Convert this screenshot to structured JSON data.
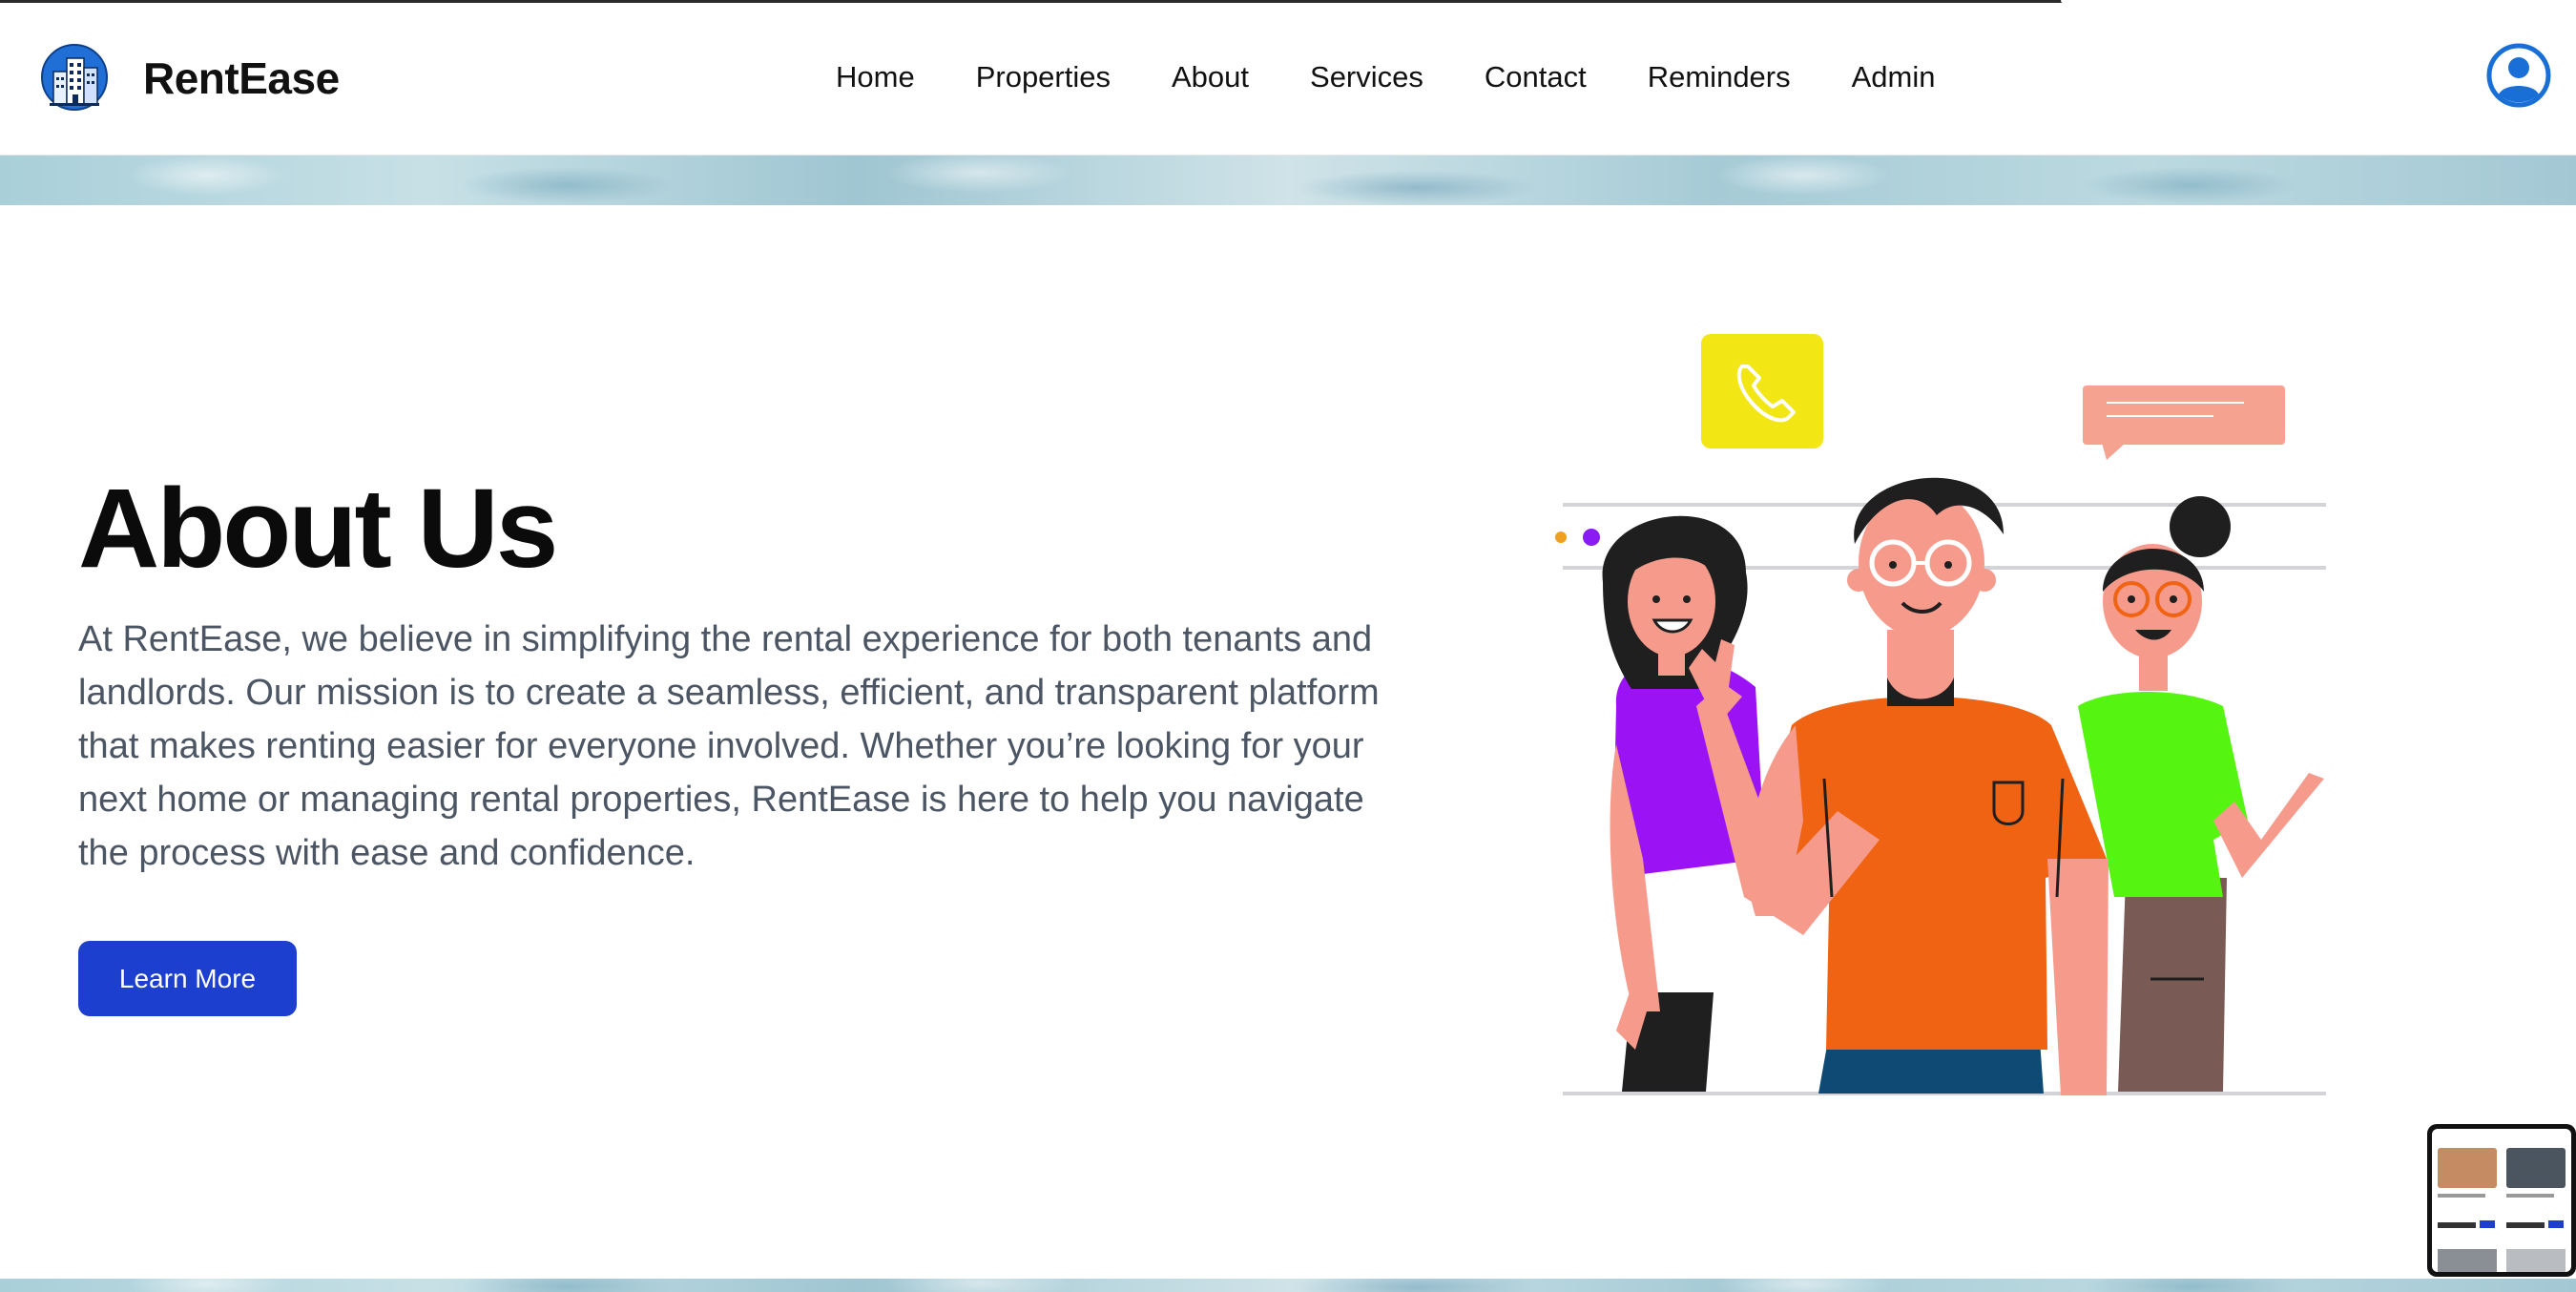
{
  "header": {
    "brand": "RentEase",
    "nav": [
      "Home",
      "Properties",
      "About",
      "Services",
      "Contact",
      "Reminders",
      "Admin"
    ],
    "user_icon": "user-circle-icon",
    "logo_icon": "building-logo-icon"
  },
  "hero": {
    "title": "About Us",
    "description": "At RentEase, we believe in simplifying the rental experience for both tenants and landlords. Our mission is to create a seamless, efficient, and transparent platform that makes renting easier for everyone involved. Whether you’re looking for your next home or managing rental properties, RentEase is here to help you navigate the process with ease and confidence.",
    "button_label": "Learn More"
  },
  "colors": {
    "accent": "#1d3fd0",
    "text_muted": "#4b5563",
    "phone_tile": "#f2e614",
    "chat_bubble": "#f6a291",
    "shirt_orange": "#f06312",
    "shirt_purple": "#9b12f5",
    "shirt_green": "#55f511"
  }
}
